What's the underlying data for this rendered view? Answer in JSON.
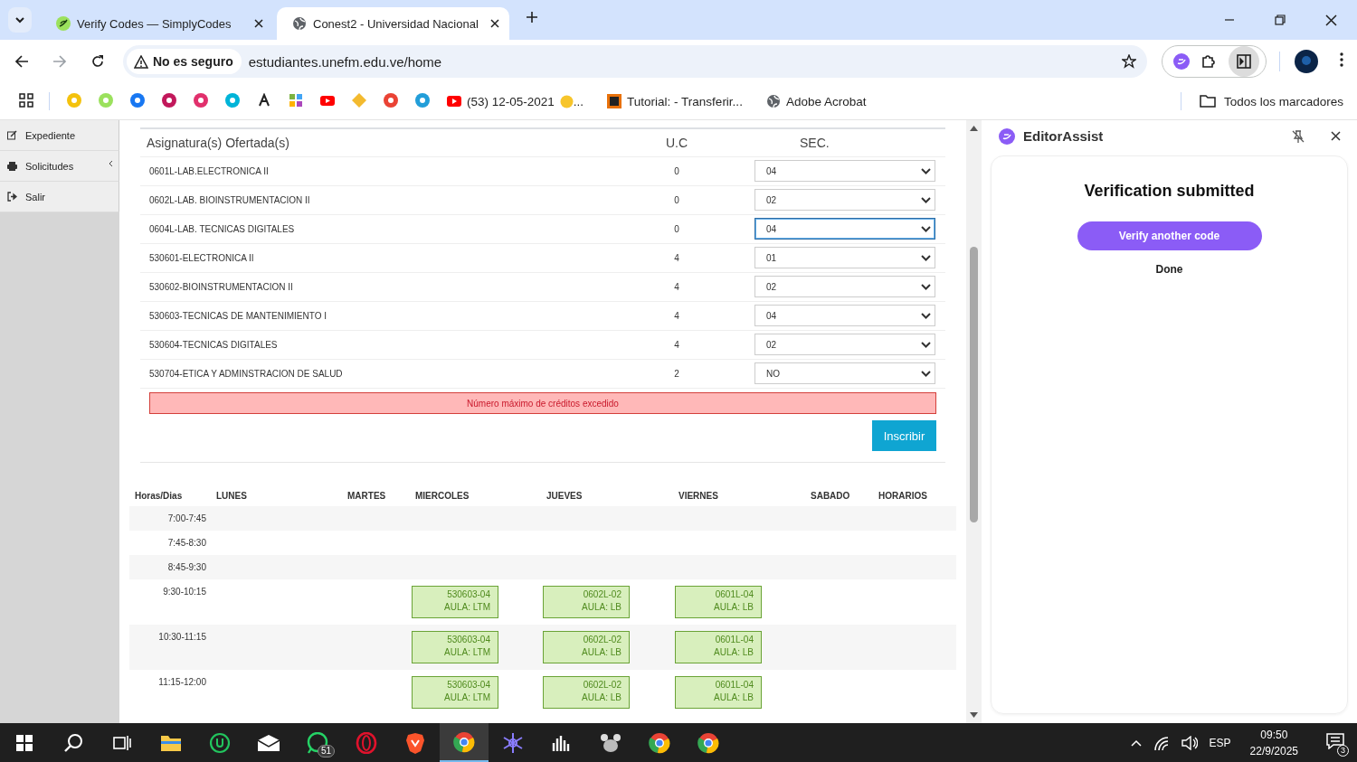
{
  "browser": {
    "tabs": [
      {
        "title": "Verify Codes — SimplyCodes",
        "selected": false
      },
      {
        "title": "Conest2 - Universidad Nacional",
        "selected": true
      }
    ],
    "security_chip": "No es seguro",
    "url": "estudiantes.unefm.edu.ve/home",
    "bookmarks": [
      {
        "label": "(53) 12-05-2021",
        "suffix": "..."
      },
      {
        "label": "Tutorial: - Transferir..."
      },
      {
        "label": "Adobe Acrobat"
      }
    ],
    "all_bookmarks": "Todos los marcadores"
  },
  "sidebar": {
    "items": [
      {
        "label": "Expediente",
        "expandable": false
      },
      {
        "label": "Solicitudes",
        "expandable": true
      },
      {
        "label": "Salir",
        "expandable": false
      }
    ]
  },
  "subjects": {
    "columns": [
      "Asignatura(s) Ofertada(s)",
      "U.C",
      "SEC."
    ],
    "rows": [
      {
        "name": "0601L-LAB.ELECTRONICA II",
        "uc": "0",
        "section": "04",
        "focused": false
      },
      {
        "name": "0602L-LAB. BIOINSTRUMENTACION II",
        "uc": "0",
        "section": "02",
        "focused": false
      },
      {
        "name": "0604L-LAB. TECNICAS DIGITALES",
        "uc": "0",
        "section": "04",
        "focused": true
      },
      {
        "name": "530601-ELECTRONICA II",
        "uc": "4",
        "section": "01",
        "focused": false
      },
      {
        "name": "530602-BIOINSTRUMENTACION II",
        "uc": "4",
        "section": "02",
        "focused": false
      },
      {
        "name": "530603-TECNICAS DE MANTENIMIENTO I",
        "uc": "4",
        "section": "04",
        "focused": false
      },
      {
        "name": "530604-TECNICAS DIGITALES",
        "uc": "4",
        "section": "02",
        "focused": false
      },
      {
        "name": "530704-ETICA Y ADMINSTRACION DE SALUD",
        "uc": "2",
        "section": "NO",
        "focused": false
      }
    ],
    "alert": "Número máximo de créditos excedido",
    "submit": "Inscribir"
  },
  "schedule": {
    "columns": [
      "Horas/Dias",
      "LUNES",
      "MARTES",
      "MIERCOLES",
      "JUEVES",
      "VIERNES",
      "SABADO",
      "HORARIOS"
    ],
    "rows": [
      {
        "time": "7:00-7:45",
        "cells": [
          {
            "kind": "empty"
          },
          {
            "kind": "empty"
          },
          {
            "kind": "empty"
          },
          {
            "kind": "empty"
          },
          {
            "kind": "empty"
          },
          {
            "kind": "empty"
          },
          {
            "kind": "empty"
          }
        ]
      },
      {
        "time": "7:45-8:30",
        "cells": [
          {
            "kind": "empty"
          },
          {
            "kind": "empty"
          },
          {
            "kind": "empty"
          },
          {
            "kind": "empty"
          },
          {
            "kind": "empty"
          },
          {
            "kind": "empty"
          },
          {
            "kind": "empty"
          }
        ]
      },
      {
        "time": "8:45-9:30",
        "cells": [
          {
            "kind": "empty"
          },
          {
            "kind": "empty"
          },
          {
            "kind": "empty"
          },
          {
            "kind": "empty"
          },
          {
            "kind": "empty"
          },
          {
            "kind": "empty"
          },
          {
            "kind": "empty"
          }
        ]
      },
      {
        "time": "9:30-10:15",
        "cells": [
          {
            "kind": "empty"
          },
          {
            "kind": "empty"
          },
          {
            "kind": "class",
            "code": "530603-04",
            "room": "AULA: LTM"
          },
          {
            "kind": "class",
            "code": "0602L-02",
            "room": "AULA: LB"
          },
          {
            "kind": "class",
            "code": "0601L-04",
            "room": "AULA: LB"
          },
          {
            "kind": "empty"
          },
          {
            "kind": "empty"
          }
        ]
      },
      {
        "time": "10:30-11:15",
        "cells": [
          {
            "kind": "empty"
          },
          {
            "kind": "empty"
          },
          {
            "kind": "class",
            "code": "530603-04",
            "room": "AULA: LTM"
          },
          {
            "kind": "class",
            "code": "0602L-02",
            "room": "AULA: LB"
          },
          {
            "kind": "class",
            "code": "0601L-04",
            "room": "AULA: LB"
          },
          {
            "kind": "empty"
          },
          {
            "kind": "empty"
          }
        ]
      },
      {
        "time": "11:15-12:00",
        "cells": [
          {
            "kind": "empty"
          },
          {
            "kind": "empty"
          },
          {
            "kind": "class",
            "code": "530603-04",
            "room": "AULA: LTM"
          },
          {
            "kind": "class",
            "code": "0602L-02",
            "room": "AULA: LB"
          },
          {
            "kind": "class",
            "code": "0601L-04",
            "room": "AULA: LB"
          },
          {
            "kind": "empty"
          },
          {
            "kind": "empty"
          }
        ]
      }
    ]
  },
  "assist": {
    "title": "EditorAssist",
    "heading": "Verification submitted",
    "primary": "Verify another code",
    "secondary": "Done"
  },
  "taskbar": {
    "apps": [
      {
        "selected": false
      },
      {
        "selected": false
      },
      {
        "selected": false
      },
      {
        "selected": false,
        "badge": "51"
      },
      {
        "selected": false
      },
      {
        "selected": false
      },
      {
        "selected": true
      },
      {
        "selected": false
      },
      {
        "selected": false
      },
      {
        "selected": false
      },
      {
        "selected": false
      },
      {
        "selected": false
      }
    ],
    "language": "ESP",
    "time": "09:50",
    "date": "22/9/2025",
    "notifications": "3"
  }
}
